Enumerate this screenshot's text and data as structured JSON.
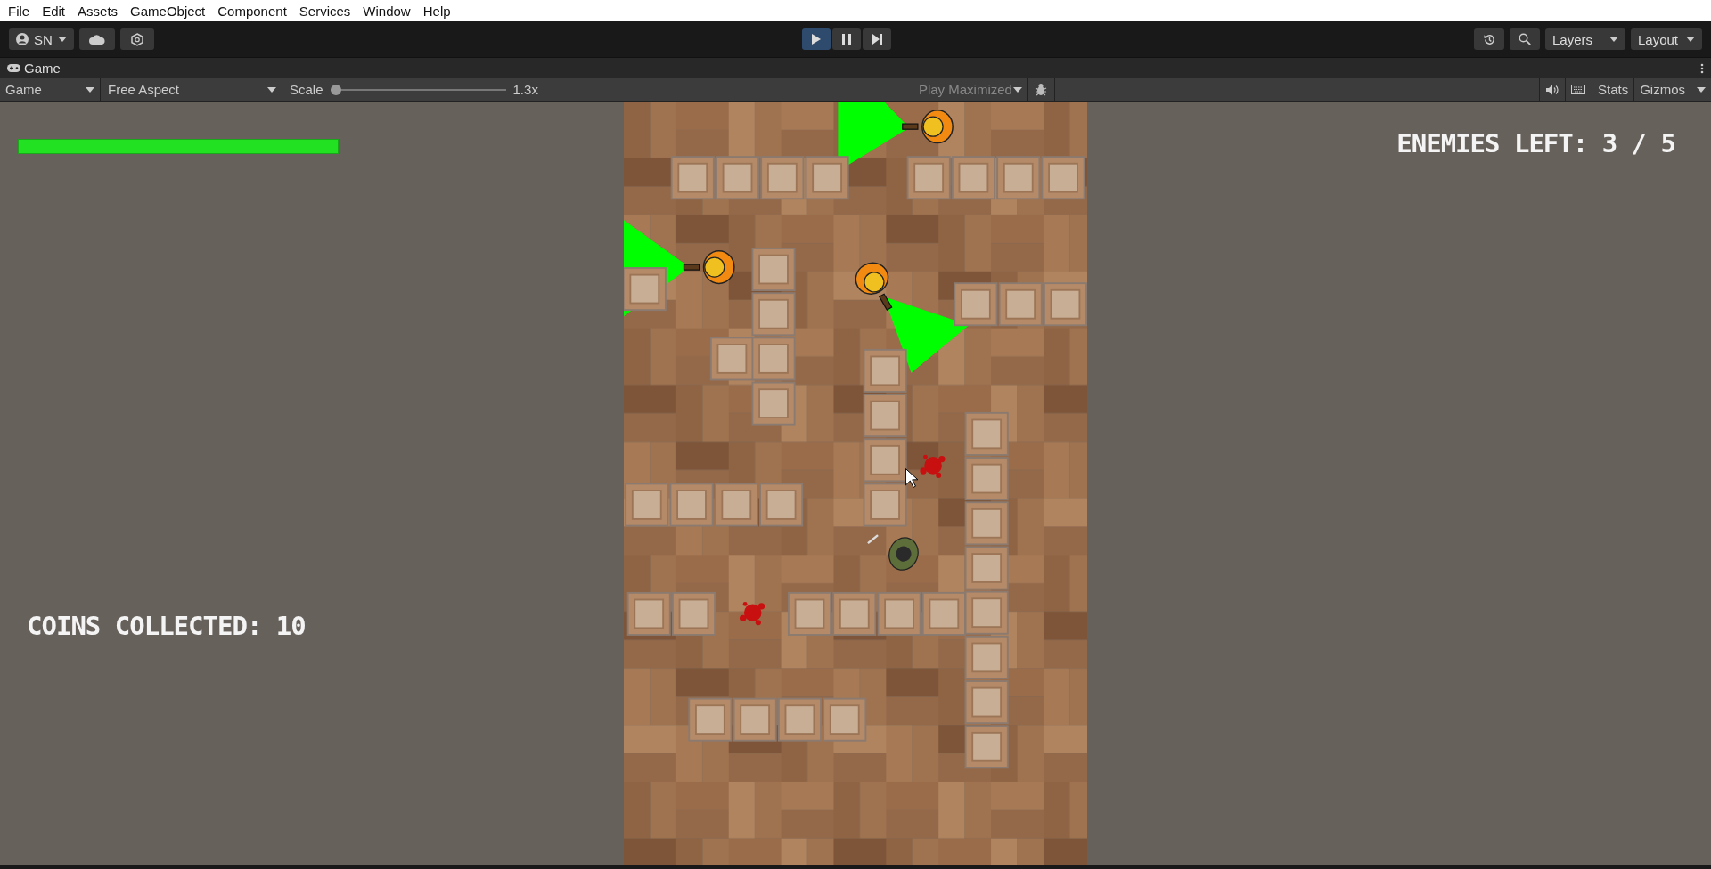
{
  "menu": [
    "File",
    "Edit",
    "Assets",
    "GameObject",
    "Component",
    "Services",
    "Window",
    "Help"
  ],
  "toolbar": {
    "account": "SN",
    "playback": [
      {
        "kind": "play",
        "selected": true
      },
      {
        "kind": "pause",
        "selected": false
      },
      {
        "kind": "step",
        "selected": false
      }
    ],
    "layers": "Layers",
    "layout": "Layout"
  },
  "tab": {
    "title": "Game"
  },
  "game_toolbar": {
    "display": "Game",
    "aspect": "Free Aspect",
    "scale_label": "Scale",
    "scale": {
      "level": 0
    },
    "scale_value": "1.3x",
    "play_mode": "Play Maximized",
    "stats": "Stats",
    "gizmos": "Gizmos"
  },
  "hud": {
    "health_bar": {
      "level": 1
    },
    "enemies_left": "ENEMIES LEFT: 3 / 5",
    "coins_collected": "COINS COLLECTED: 10"
  }
}
